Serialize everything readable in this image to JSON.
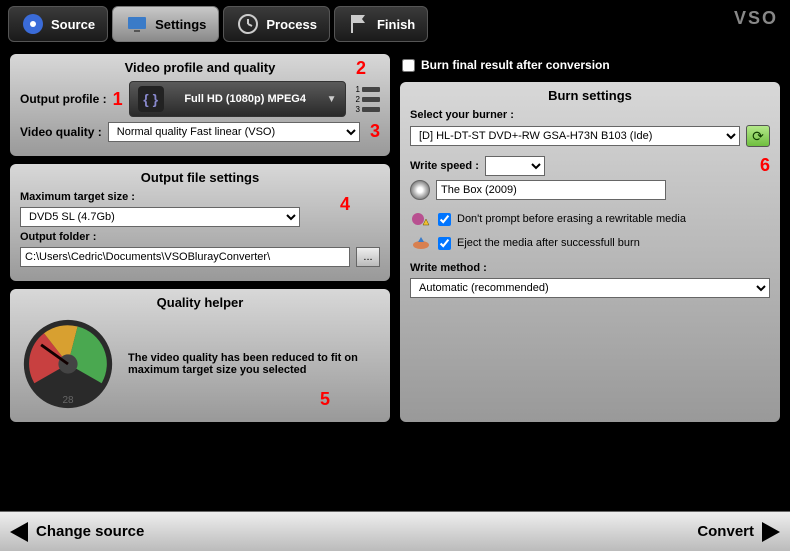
{
  "nav": {
    "source": "Source",
    "settings": "Settings",
    "process": "Process",
    "finish": "Finish",
    "logo": "VSO"
  },
  "panels": {
    "video_profile": {
      "title": "Video profile and quality",
      "output_profile_label": "Output profile :",
      "profile_value": "Full HD (1080p) MPEG4",
      "video_quality_label": "Video quality :",
      "video_quality_value": "Normal quality Fast linear (VSO)"
    },
    "output_file": {
      "title": "Output file settings",
      "max_size_label": "Maximum target size :",
      "max_size_value": "DVD5 SL (4.7Gb)",
      "folder_label": "Output folder :",
      "folder_value": "C:\\Users\\Cedric\\Documents\\VSOBlurayConverter\\"
    },
    "quality_helper": {
      "title": "Quality helper",
      "message": "The video quality has been reduced to fit on maximum target size you selected",
      "gauge_value": "28"
    },
    "burn_check": "Burn final result after conversion",
    "burn_settings": {
      "title": "Burn settings",
      "burner_label": "Select your burner :",
      "burner_value": "[D] HL-DT-ST DVD+-RW GSA-H73N B103 (Ide)",
      "write_speed_label": "Write speed :",
      "disc_label_value": "The Box (2009)",
      "dont_prompt": "Don't prompt before erasing a rewritable media",
      "eject": "Eject the media after successfull burn",
      "write_method_label": "Write method :",
      "write_method_value": "Automatic (recommended)"
    }
  },
  "bottom": {
    "change_source": "Change source",
    "convert": "Convert"
  },
  "annotations": {
    "a1": "1",
    "a2": "2",
    "a3": "3",
    "a4": "4",
    "a5": "5",
    "a6": "6"
  }
}
